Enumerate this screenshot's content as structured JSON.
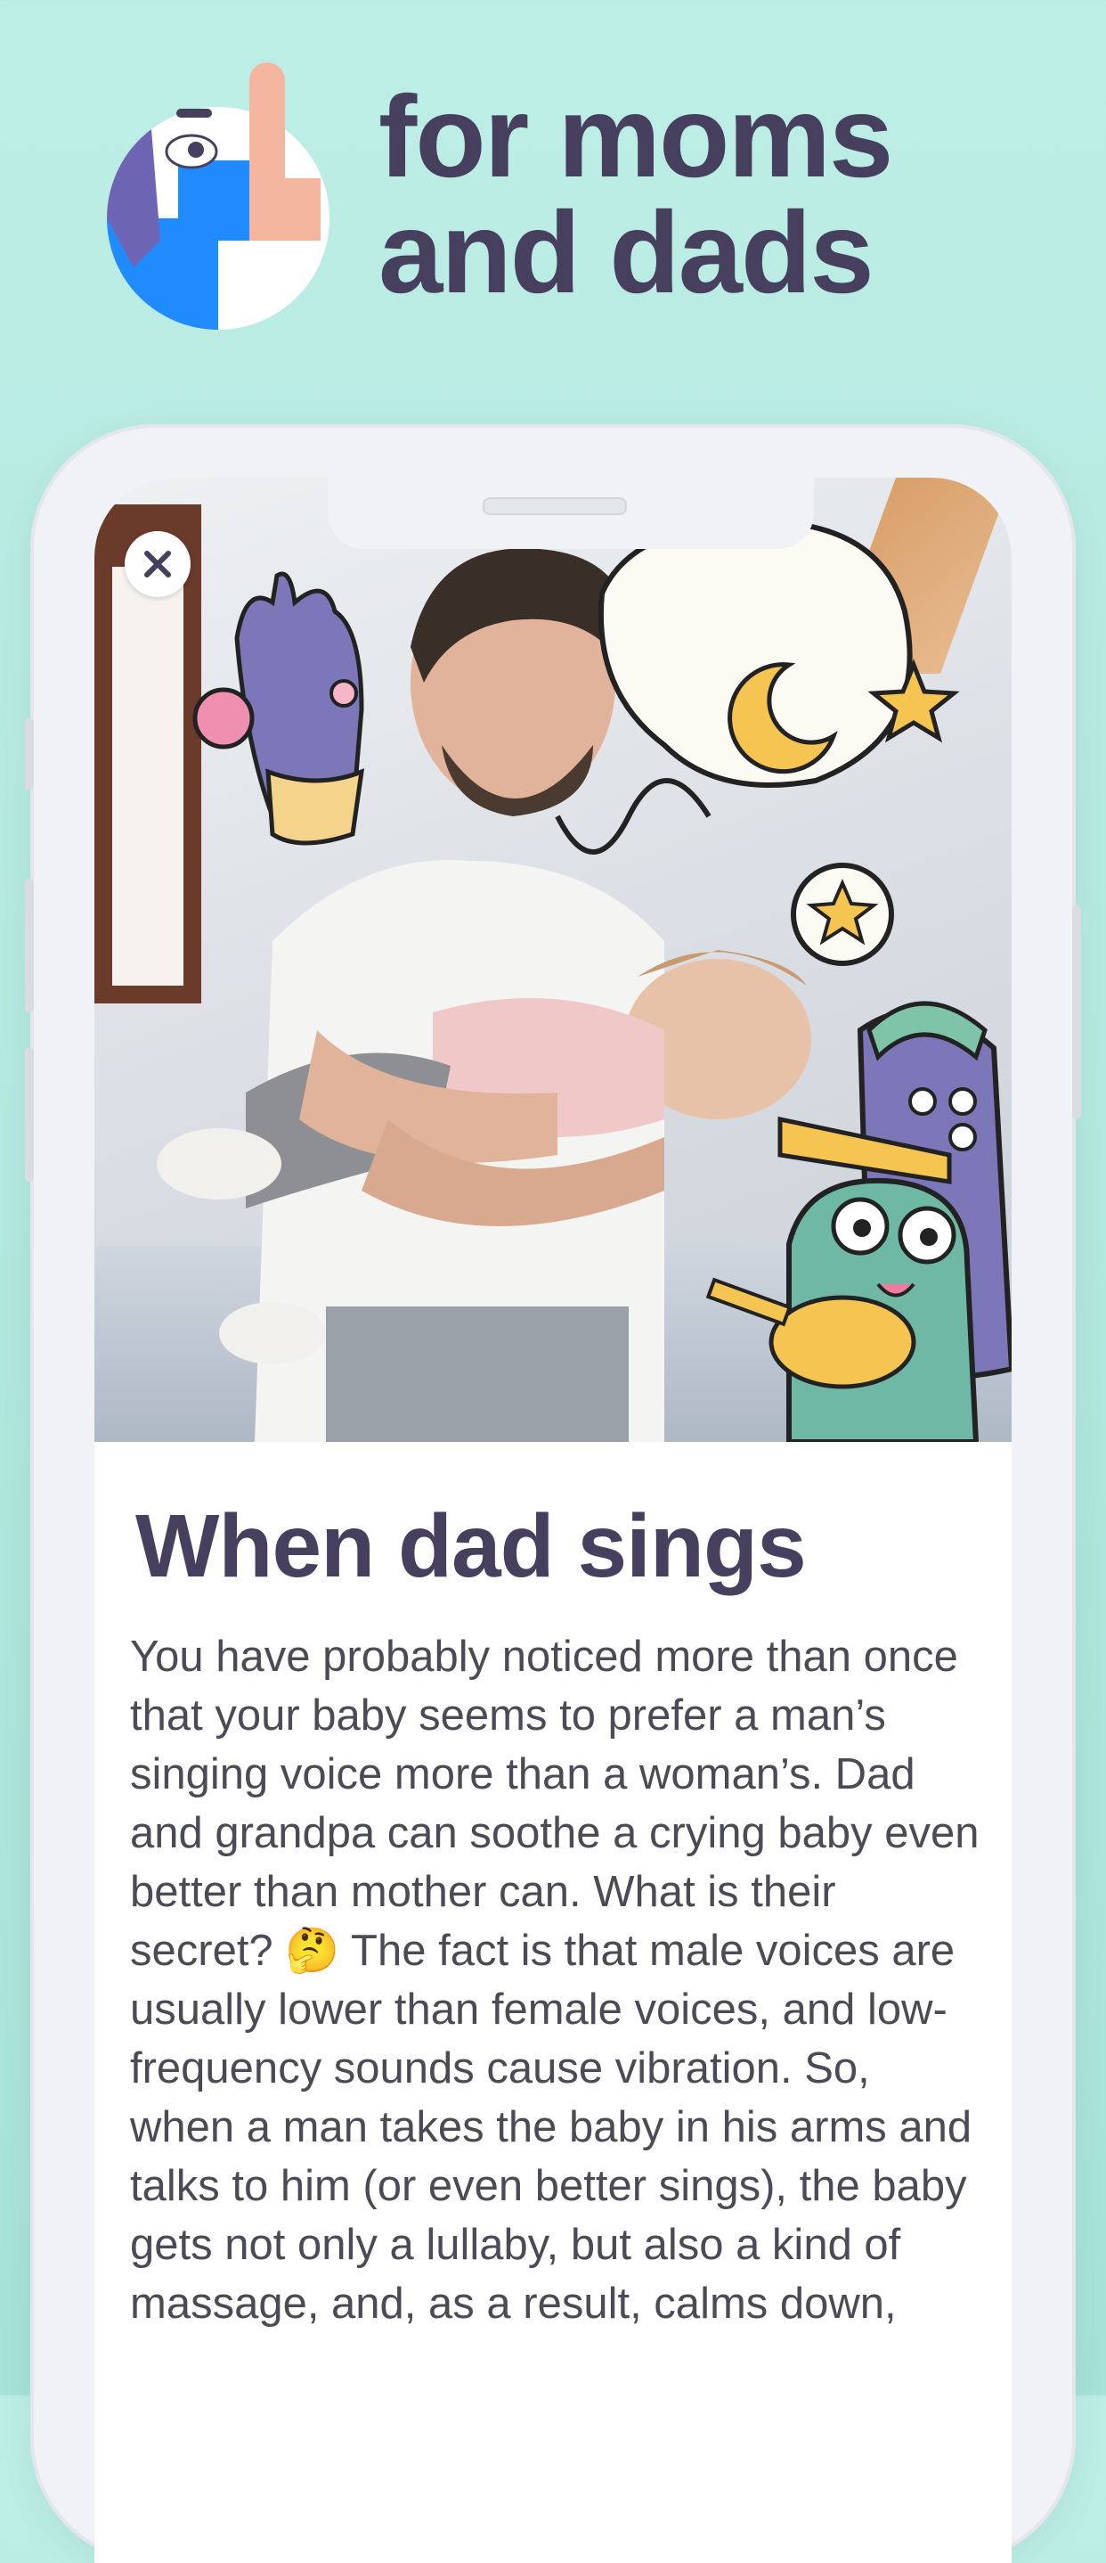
{
  "header": {
    "headline_line1": "for moms",
    "headline_line2": "and dads"
  },
  "article": {
    "title": "When dad sings",
    "body": "You have probably noticed more than once that your baby seems to prefer a man’s singing voice more than a woman’s. Dad and grandpa can soothe a crying baby even better than mother can. What is their secret? 🤔 The fact is that male voices are usually lower than female voices, and low-frequency sounds cause vibration. So, when a man takes the baby in his arms and talks to him (or even better sings), the baby gets not only a lullaby, but also a kind of massage, and, as a result, calms down,"
  },
  "icons": {
    "close": "close-icon",
    "logo": "app-logo-icon"
  },
  "colors": {
    "background": "#bdeee6",
    "headline": "#463f5e",
    "logo_blue": "#1f8bff",
    "logo_purple": "#6e64b4",
    "logo_skin": "#f5b6a0"
  }
}
